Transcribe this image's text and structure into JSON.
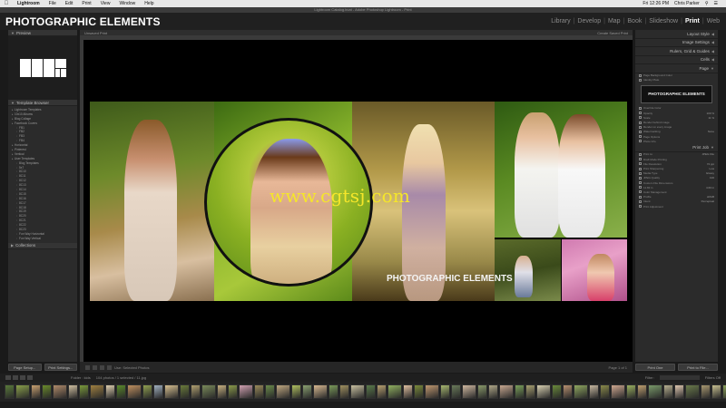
{
  "menubar": {
    "apple_icon": "apple-icon",
    "items": [
      "Lightroom",
      "File",
      "Edit",
      "Print",
      "View",
      "Window",
      "Help"
    ],
    "clock": "Fri 12:26 PM",
    "user": "Chris Parker"
  },
  "window_title": "Lightroom Catalog.lrcat - Adobe Photoshop Lightroom - Print",
  "identity_plate": "PHOTOGRAPHIC ELEMENTS",
  "modules": {
    "items": [
      "Library",
      "Develop",
      "Map",
      "Book",
      "Slideshow",
      "Print",
      "Web"
    ],
    "active": "Print"
  },
  "left_panel": {
    "preview_label": "Preview",
    "template_browser_label": "Template Browser",
    "collections_label": "Collections",
    "tree": [
      {
        "level": 0,
        "label": "Lightroom Templates"
      },
      {
        "level": 0,
        "label": "10x10 Albums"
      },
      {
        "level": 0,
        "label": "Blog Collage"
      },
      {
        "level": 0,
        "label": "Facebook Covers"
      },
      {
        "level": 1,
        "label": "FB1"
      },
      {
        "level": 1,
        "label": "FB2"
      },
      {
        "level": 1,
        "label": "FB3"
      },
      {
        "level": 1,
        "label": "FB4"
      },
      {
        "level": 0,
        "label": "Horizontal"
      },
      {
        "level": 0,
        "label": "Pinterest"
      },
      {
        "level": 0,
        "label": "Vertical"
      },
      {
        "level": 0,
        "label": "User Templates"
      },
      {
        "level": 1,
        "label": "Blog Templates"
      },
      {
        "level": 1,
        "label": "5x7"
      },
      {
        "level": 1,
        "label": "8C10"
      },
      {
        "level": 1,
        "label": "8C11"
      },
      {
        "level": 1,
        "label": "8C12"
      },
      {
        "level": 1,
        "label": "8C13"
      },
      {
        "level": 1,
        "label": "8C14"
      },
      {
        "level": 1,
        "label": "8C15"
      },
      {
        "level": 1,
        "label": "8C16"
      },
      {
        "level": 1,
        "label": "8C17"
      },
      {
        "level": 1,
        "label": "8C18"
      },
      {
        "level": 1,
        "label": "8C19"
      },
      {
        "level": 1,
        "label": "8C20"
      },
      {
        "level": 1,
        "label": "8C21"
      },
      {
        "level": 1,
        "label": "8C22"
      },
      {
        "level": 1,
        "label": "8C23"
      },
      {
        "level": 1,
        "label": "Fun Way Horizontal"
      },
      {
        "level": 1,
        "label": "Fun Way Vertical"
      }
    ],
    "page_setup_button": "Page Setup...",
    "print_settings_button": "Print Settings..."
  },
  "center": {
    "header_left": "Unsaved Print",
    "header_right": "Create Saved Print",
    "watermark_text": "www.cgtsj.com",
    "page_logo_text": "PHOTOGRAPHIC ELEMENTS",
    "toolbar_text": "Use: Selected Photos",
    "page_count": "Page 1 of 1"
  },
  "right_panel": {
    "sections": [
      "Layout Style",
      "Image Settings",
      "Rulers, Grid & Guides",
      "Cells"
    ],
    "page_section": "Page",
    "page_lines": [
      {
        "label": "Page Background Color",
        "value": ""
      },
      {
        "label": "Identity Plate",
        "value": ""
      }
    ],
    "identity_plate_preview": "PHOTOGRAPHIC ELEMENTS",
    "page_sub_lines": [
      {
        "label": "Override Color",
        "value": ""
      },
      {
        "label": "Opacity",
        "value": "100 %"
      },
      {
        "label": "Scale",
        "value": "11 %"
      },
      {
        "label": "Render behind image",
        "value": ""
      },
      {
        "label": "Render on every image",
        "value": ""
      },
      {
        "label": "Watermarking",
        "value": "None"
      },
      {
        "label": "Page Options",
        "value": ""
      },
      {
        "label": "Photo Info",
        "value": ""
      }
    ],
    "print_job_section": "Print Job",
    "print_job_lines": [
      {
        "label": "Print to:",
        "value": "JPEG File"
      },
      {
        "label": "Draft Mode Printing",
        "value": ""
      },
      {
        "label": "File Resolution",
        "value": "72 ppi"
      },
      {
        "label": "Print Sharpening",
        "value": "Low"
      },
      {
        "label": "Media Type",
        "value": "Glossy"
      },
      {
        "label": "JPEG Quality",
        "value": "100"
      },
      {
        "label": "Custom File Dimensions",
        "value": ""
      },
      {
        "label": "11.82 in",
        "value": "4.60 in"
      },
      {
        "label": "Color Management",
        "value": ""
      },
      {
        "label": "Profile",
        "value": "sRGB"
      },
      {
        "label": "Intent",
        "value": "Perceptual"
      },
      {
        "label": "Print Adjustment",
        "value": ""
      }
    ],
    "print_one_button": "Print One",
    "print_to_file_button": "Print to File..."
  },
  "filmbar": {
    "source": "Folder : kids",
    "counts": "104 photos / 1 selected / 11.jpg",
    "filter_label": "Filter:",
    "filter_value": "Filters Off"
  },
  "filmstrip_thumbs": [
    "#5a7a3a",
    "#8aa04a",
    "#c8a070",
    "#6a8a2a",
    "#b08a6a",
    "#d0c0a0",
    "#7a9a3a",
    "#a08040",
    "#e0d0b0",
    "#5a8a2a",
    "#c09060",
    "#90a050",
    "#a0b0c0",
    "#d8c090",
    "#6a7a3a",
    "#b0a070",
    "#7a8a5a",
    "#c8b080",
    "#8a9a4a",
    "#d0a0b0",
    "#9a8a5a",
    "#6a8a4a",
    "#c0a880",
    "#b0c060",
    "#8aa070",
    "#d8b890",
    "#7a9a5a",
    "#a09060",
    "#c8c0a0",
    "#5a7a4a",
    "#b8a070",
    "#90b060",
    "#e0c0a0",
    "#7a8a3a",
    "#c09870",
    "#a8b870",
    "#6a7a5a",
    "#d0b8a0",
    "#8a9a6a",
    "#b0a888",
    "#c8a890",
    "#7aa05a",
    "#a8a070",
    "#d8d0b0",
    "#6a8a3a",
    "#b89070",
    "#90a860",
    "#c8b8a0",
    "#8a8a4a",
    "#d0a890",
    "#9ab060",
    "#c0a070",
    "#7a9a6a",
    "#b8b090",
    "#e0c8b0",
    "#6a7a4a",
    "#a89870",
    "#c8c090",
    "#8aa05a",
    "#d0b8b0"
  ]
}
